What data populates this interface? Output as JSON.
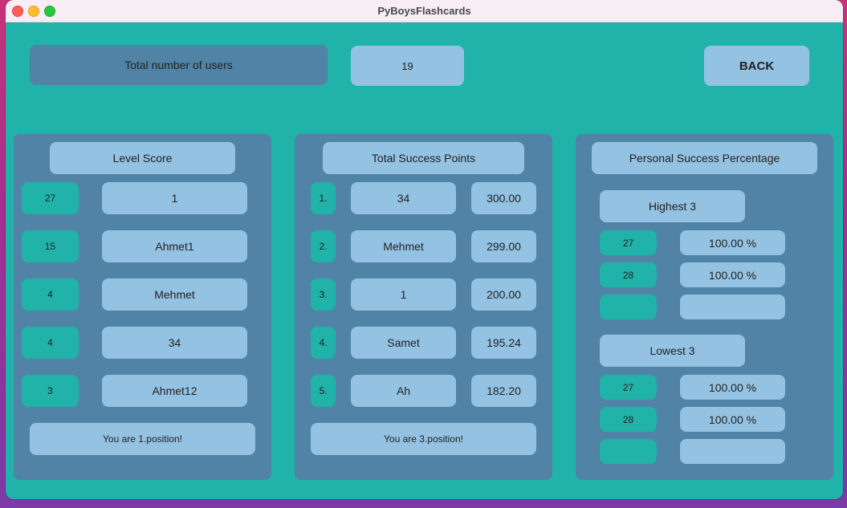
{
  "window": {
    "title": "PyBoysFlashcards"
  },
  "header": {
    "users_label": "Total number of users",
    "users_value": "19",
    "back_label": "BACK"
  },
  "level_score": {
    "title": "Level Score",
    "rows": [
      {
        "level": "27",
        "name": "1"
      },
      {
        "level": "15",
        "name": "Ahmet1"
      },
      {
        "level": "4",
        "name": "Mehmet"
      },
      {
        "level": "4",
        "name": "34"
      },
      {
        "level": "3",
        "name": "Ahmet12"
      }
    ],
    "position": "You are 1.position!"
  },
  "success_points": {
    "title": "Total Success Points",
    "rows": [
      {
        "rank": "1.",
        "name": "34",
        "points": "300.00"
      },
      {
        "rank": "2.",
        "name": "Mehmet",
        "points": "299.00"
      },
      {
        "rank": "3.",
        "name": "1",
        "points": "200.00"
      },
      {
        "rank": "4.",
        "name": "Samet",
        "points": "195.24"
      },
      {
        "rank": "5.",
        "name": "Ah",
        "points": "182.20"
      }
    ],
    "position": "You are 3.position!"
  },
  "percentage": {
    "title": "Personal Success Percentage",
    "highest_label": "Highest 3",
    "highest": [
      {
        "level": "27",
        "pct": "100.00 %"
      },
      {
        "level": "28",
        "pct": "100.00 %"
      },
      {
        "level": "",
        "pct": ""
      }
    ],
    "lowest_label": "Lowest 3",
    "lowest": [
      {
        "level": "27",
        "pct": "100.00 %"
      },
      {
        "level": "28",
        "pct": "100.00 %"
      },
      {
        "level": "",
        "pct": ""
      }
    ]
  }
}
